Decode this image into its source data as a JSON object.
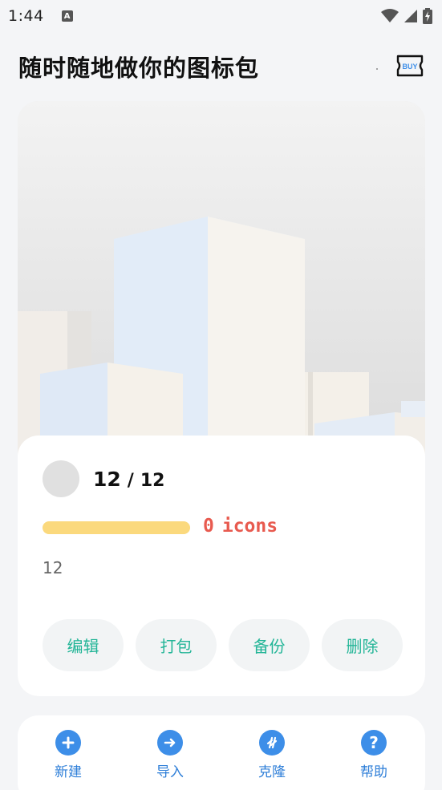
{
  "status_bar": {
    "time": "1:44",
    "notification_icon": "a-icon",
    "icons": [
      "wifi-icon",
      "signal-icon",
      "battery-charging-icon"
    ]
  },
  "header": {
    "title": "随时随地做你的图标包",
    "buy_icon": "ticket-buy-icon",
    "buy_label": "BUY"
  },
  "pack": {
    "count": "12",
    "separator": "/",
    "total": "12",
    "progress": 1.0,
    "icons_value": "0",
    "icons_label": "icons",
    "name": "12"
  },
  "actions": [
    {
      "label": "编辑"
    },
    {
      "label": "打包"
    },
    {
      "label": "备份"
    },
    {
      "label": "删除"
    }
  ],
  "nav": [
    {
      "label": "新建",
      "icon": "plus-icon"
    },
    {
      "label": "导入",
      "icon": "arrow-right-icon"
    },
    {
      "label": "克隆",
      "icon": "clone-icon"
    },
    {
      "label": "帮助",
      "icon": "help-icon"
    }
  ],
  "colors": {
    "accent_green": "#23b597",
    "accent_blue": "#3d8ee8",
    "icons_red": "#e85a4f",
    "progress": "#fbd97d"
  }
}
